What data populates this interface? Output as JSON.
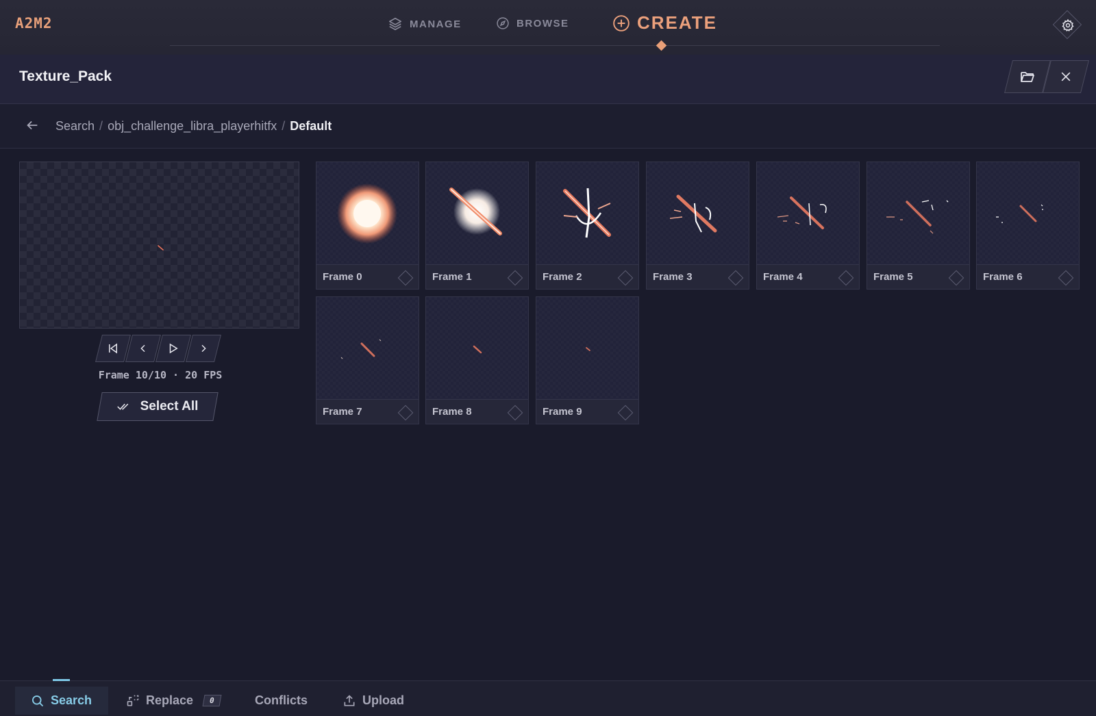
{
  "app": {
    "logo": "A2M2"
  },
  "nav": {
    "manage": "MANAGE",
    "browse": "BROWSE",
    "create": "CREATE"
  },
  "header": {
    "title": "Texture_Pack"
  },
  "breadcrumb": {
    "items": [
      "Search",
      "obj_challenge_libra_playerhitfx",
      "Default"
    ],
    "separator": "/"
  },
  "player": {
    "status": "Frame 10/10 · 20 FPS",
    "select_all": "Select All",
    "current_frame": 10,
    "frame_count": 10,
    "fps": 20
  },
  "frames": [
    {
      "label": "Frame 0"
    },
    {
      "label": "Frame 1"
    },
    {
      "label": "Frame 2"
    },
    {
      "label": "Frame 3"
    },
    {
      "label": "Frame 4"
    },
    {
      "label": "Frame 5"
    },
    {
      "label": "Frame 6"
    },
    {
      "label": "Frame 7"
    },
    {
      "label": "Frame 8"
    },
    {
      "label": "Frame 9"
    }
  ],
  "bottom_tabs": {
    "search": "Search",
    "replace": "Replace",
    "replace_count": "0",
    "conflicts": "Conflicts",
    "upload": "Upload"
  },
  "colors": {
    "accent": "#e99f78",
    "active_tab": "#7ec7e6",
    "background": "#1a1b2b"
  }
}
